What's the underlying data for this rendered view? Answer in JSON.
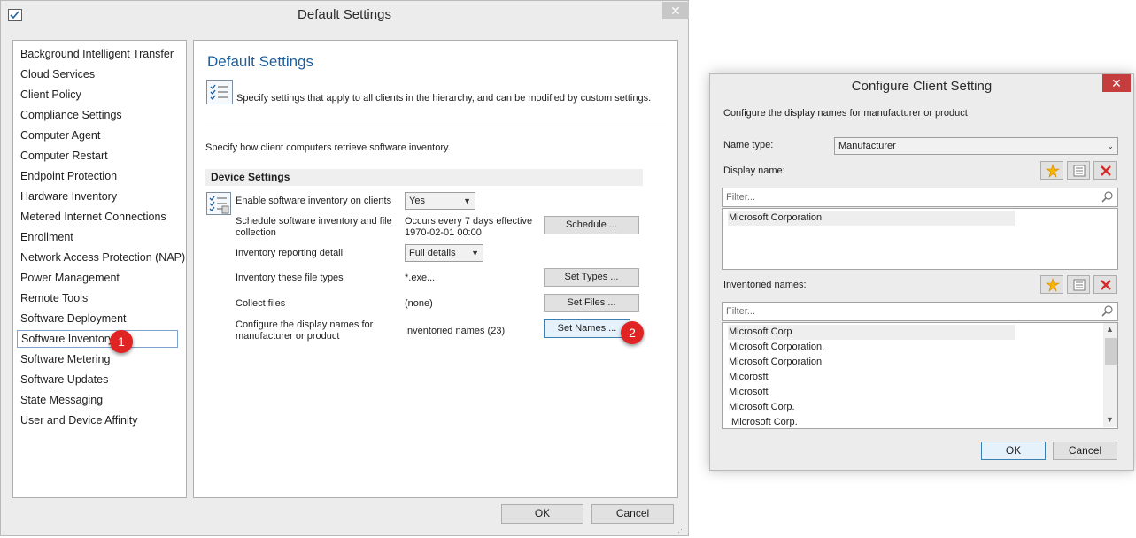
{
  "main_window": {
    "title": "Default Settings",
    "close_symbol": "✕",
    "nav_items": [
      "Background Intelligent Transfer",
      "Cloud Services",
      "Client Policy",
      "Compliance Settings",
      "Computer Agent",
      "Computer Restart",
      "Endpoint Protection",
      "Hardware Inventory",
      "Metered Internet Connections",
      "Enrollment",
      "Network Access Protection (NAP)",
      "Power Management",
      "Remote Tools",
      "Software Deployment",
      "Software Inventory",
      "Software Metering",
      "Software Updates",
      "State Messaging",
      "User and Device Affinity"
    ],
    "selected_nav": "Software Inventory",
    "page_title": "Default Settings",
    "description": "Specify settings that apply to all clients in the hierarchy, and can be modified by custom settings.",
    "subtitle": "Specify how client computers retrieve software inventory.",
    "group_header": "Device Settings",
    "settings": {
      "enable_label": "Enable software inventory on clients",
      "enable_value": "Yes",
      "schedule_label": "Schedule software inventory and file collection",
      "schedule_value": "Occurs every 7 days effective 1970-02-01 00:00",
      "schedule_button": "Schedule ...",
      "reporting_label": "Inventory reporting detail",
      "reporting_value": "Full details",
      "filetypes_label": "Inventory these file types",
      "filetypes_value": "*.exe...",
      "filetypes_button": "Set Types ...",
      "collect_label": "Collect files",
      "collect_value": "(none)",
      "collect_button": "Set Files ...",
      "names_label": "Configure the display names for manufacturer or product",
      "names_value": "Inventoried names (23)",
      "names_button": "Set Names ..."
    },
    "ok_button": "OK",
    "cancel_button": "Cancel",
    "step_badges": [
      "1",
      "2"
    ]
  },
  "configure_window": {
    "title": "Configure Client Setting",
    "close_symbol": "✕",
    "description": "Configure the display names for manufacturer or product",
    "name_type_label": "Name type:",
    "name_type_value": "Manufacturer",
    "display_name_label": "Display name:",
    "display_filter_placeholder": "Filter...",
    "display_names": [
      "Microsoft Corporation"
    ],
    "inventoried_label": "Inventoried names:",
    "inventoried_filter_placeholder": "Filter...",
    "inventoried_names": [
      "Microsoft Corp",
      "Microsoft Corporation.",
      "Microsoft Corporation",
      "Micorosft",
      "Microsoft",
      "Microsoft Corp.",
      " Microsoft Corp."
    ],
    "ok_button": "OK",
    "cancel_button": "Cancel"
  },
  "colors": {
    "accent_title": "#1d5f9e",
    "badge_red": "#e02424",
    "close_red": "#c53d3d",
    "selection_border": "#7da2ce"
  },
  "icons": [
    "settings-checklist-icon",
    "new-star-icon",
    "properties-icon",
    "delete-x-icon",
    "magnifier-icon",
    "dropdown-arrow-icon"
  ]
}
